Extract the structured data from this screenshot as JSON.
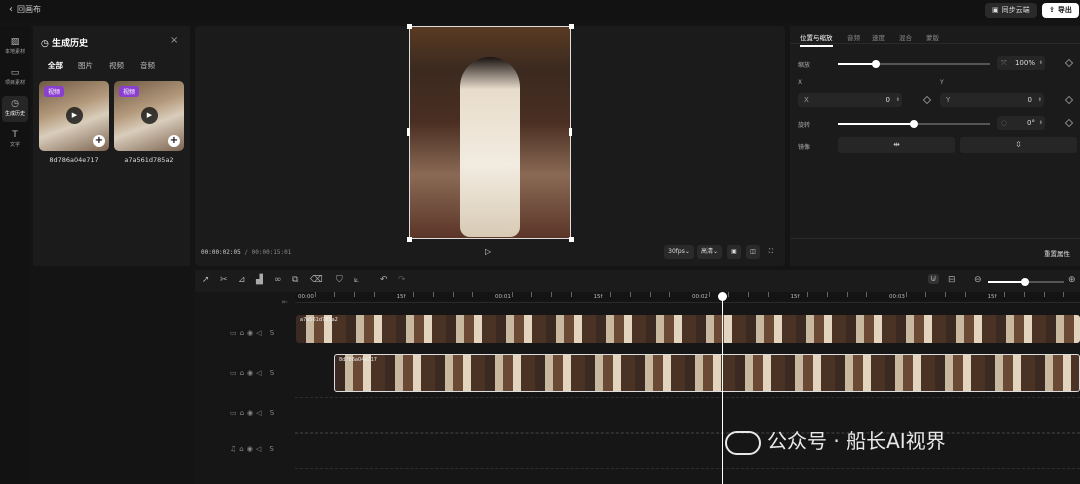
{
  "topbar": {
    "back_label": "回画布",
    "sync_label": "同步云端",
    "export_label": "导出"
  },
  "leftnav": [
    {
      "label": "本地素材",
      "icon": "image-icon"
    },
    {
      "label": "项目素材",
      "icon": "folder-icon"
    },
    {
      "label": "生成历史",
      "icon": "history-icon",
      "active": true
    },
    {
      "label": "文字",
      "icon": "text-icon"
    }
  ],
  "history_panel": {
    "title": "生成历史",
    "tabs": [
      "全部",
      "图片",
      "视频",
      "音频"
    ],
    "active_tab": "全部",
    "cards": [
      {
        "badge": "视频",
        "name": "8d786a04e717"
      },
      {
        "badge": "视频",
        "name": "a7a561d785a2"
      }
    ]
  },
  "preview": {
    "current_time": "00:00:02:05",
    "separator": "/",
    "total_time": "00:00:15:01",
    "fps_label": "30fps",
    "quality_label": "高清"
  },
  "props": {
    "tabs": [
      "位置与缩放",
      "音频",
      "速度",
      "混合",
      "蒙版"
    ],
    "active_tab": "位置与缩放",
    "scale_label": "缩放",
    "scale_value": "100",
    "scale_unit": "%",
    "scale_level": 0.25,
    "x_label": "X",
    "x_field_label": "X",
    "x_value": "0",
    "y_label": "Y",
    "y_field_label": "Y",
    "y_value": "0",
    "rotate_label": "旋转",
    "rotate_value": "0",
    "rotate_unit": "°",
    "rotate_level": 0.5,
    "mirror_label": "镜像",
    "reset_label": "重置属性"
  },
  "timeline": {
    "ruler_labels": [
      "00:00",
      "15f",
      "00:01",
      "15f",
      "00:02",
      "15f",
      "00:03",
      "15f"
    ],
    "tracks": [
      {
        "name": "a7a561d785a2"
      },
      {
        "name": "8d786a04e717"
      }
    ]
  },
  "watermark": {
    "text": "公众号 · 船长AI视界"
  }
}
